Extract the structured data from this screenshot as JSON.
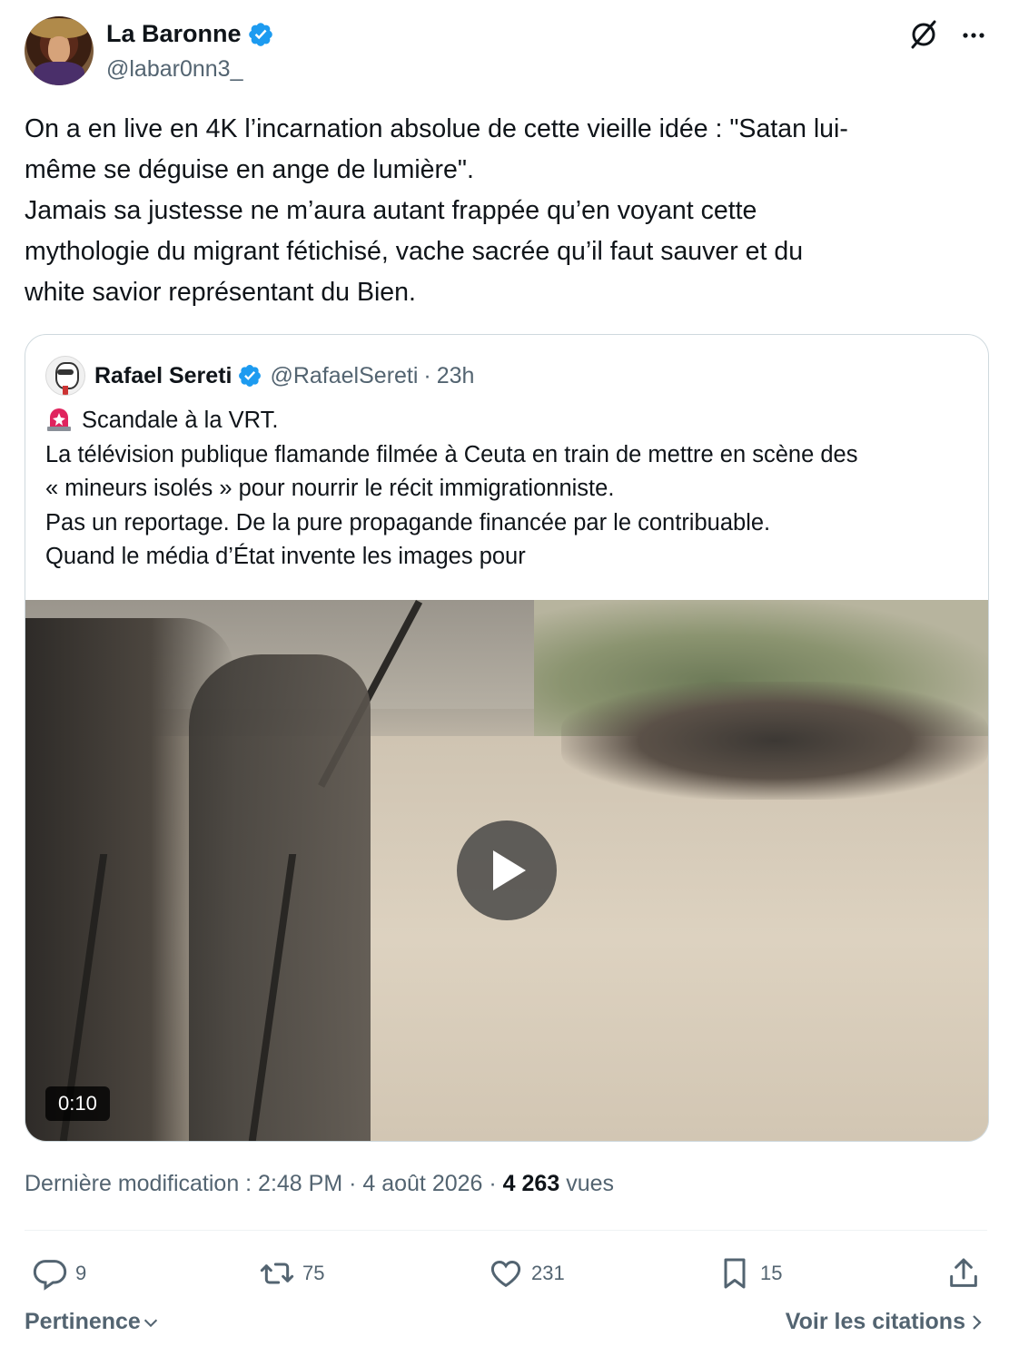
{
  "author": {
    "display_name": "La Baronne",
    "handle": "@labar0nn3_"
  },
  "tweet": {
    "text": "On a en live en 4K l’incarnation absolue de cette vieille idée : \"Satan lui-\nmême se déguise en ange de lumière\".\nJamais sa justesse ne m’aura autant frappée qu’en voyant cette\nmythologie du migrant fétichisé, vache sacrée qu’il faut sauver et du\nwhite savior représentant du Bien."
  },
  "quoted": {
    "display_name": "Rafael Sereti",
    "handle": "@RafaelSereti",
    "separator": "·",
    "time": "23h",
    "text": "Scandale à la VRT.\nLa télévision publique flamande filmée à Ceuta en train de mettre en scène des\n« mineurs isolés » pour nourrir le récit immigrationniste.\nPas un reportage. De la pure propagande financée par le contribuable.\nQuand le média d’État invente les images pour",
    "video": {
      "duration": "0:10"
    }
  },
  "meta": {
    "edited_label": "Dernière modification : 2:48 PM · 4 août 2026 ·",
    "views_count": "4 263",
    "views_label": "vues"
  },
  "actions": {
    "replies": "9",
    "reposts": "75",
    "likes": "231",
    "bookmarks": "15"
  },
  "footer": {
    "sort_label": "Pertinence",
    "quotes_label": "Voir les citations"
  },
  "colors": {
    "text": "#0f1419",
    "secondary": "#536471",
    "verified": "#1d9bf0",
    "border": "#cfd9de"
  },
  "icons": [
    "verified-badge-icon",
    "grok-icon",
    "more-icon",
    "siren-icon",
    "play-icon",
    "reply-icon",
    "repost-icon",
    "like-icon",
    "bookmark-icon",
    "share-icon",
    "chevron-down-icon",
    "chevron-right-icon"
  ]
}
